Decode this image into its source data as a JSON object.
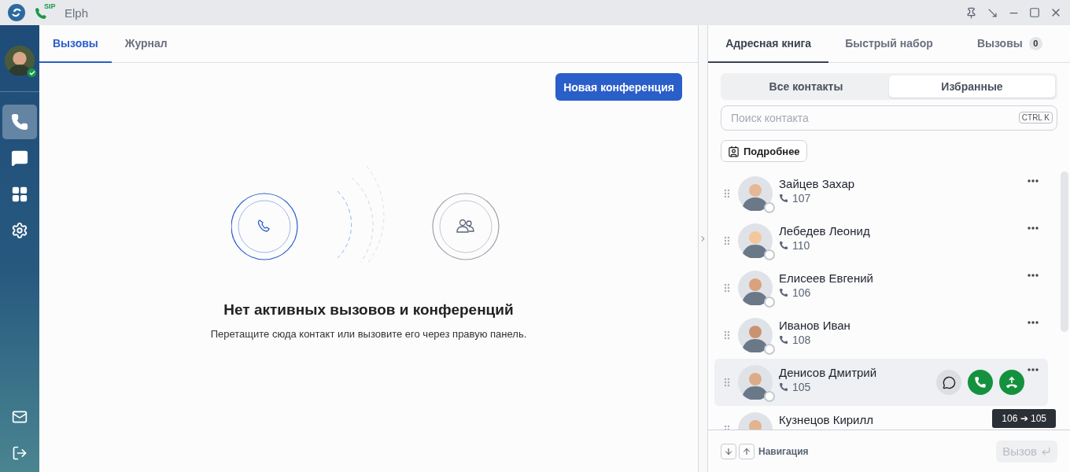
{
  "window": {
    "title": "Elph",
    "sip_label": "SIP"
  },
  "user": {
    "online": true
  },
  "nav": [
    {
      "kind": "calls",
      "selected": true
    },
    {
      "kind": "chat",
      "selected": false
    },
    {
      "kind": "apps",
      "selected": false
    },
    {
      "kind": "settings",
      "selected": false
    }
  ],
  "nav_bottom": [
    {
      "kind": "mail"
    },
    {
      "kind": "logout"
    }
  ],
  "main": {
    "tabs": [
      {
        "label": "Вызовы",
        "selected": true
      },
      {
        "label": "Журнал",
        "selected": false
      }
    ],
    "new_conference_button": "Новая конференция",
    "empty_title": "Нет активных вызовов и конференций",
    "empty_hint": "Перетащите сюда контакт или вызовите его через правую панель."
  },
  "side": {
    "tabs": [
      {
        "label": "Адресная книга",
        "selected": true
      },
      {
        "label": "Быстрый набор",
        "selected": false
      },
      {
        "label": "Вызовы",
        "selected": false,
        "badge": "0"
      }
    ],
    "filter": [
      {
        "label": "Все контакты",
        "selected": false
      },
      {
        "label": "Избранные",
        "selected": true
      }
    ],
    "search": {
      "placeholder": "Поиск контакта",
      "shortcut": "CTRL K"
    },
    "details_button": "Подробнее",
    "contacts": [
      {
        "name": "Зайцев Захар",
        "number": "107",
        "online": false,
        "hovered": false
      },
      {
        "name": "Лебедев Леонид",
        "number": "110",
        "online": false,
        "hovered": false
      },
      {
        "name": "Елисеев Евгений",
        "number": "106",
        "online": false,
        "hovered": false
      },
      {
        "name": "Иванов Иван",
        "number": "108",
        "online": false,
        "hovered": false
      },
      {
        "name": "Денисов Дмитрий",
        "number": "105",
        "online": false,
        "hovered": true,
        "tooltip": "106 ➔ 105"
      },
      {
        "name": "Кузнецов Кирилл",
        "hovered": false
      }
    ],
    "footer": {
      "navigation": "Навигация",
      "call_button": "Вызов",
      "call_disabled": true
    }
  }
}
